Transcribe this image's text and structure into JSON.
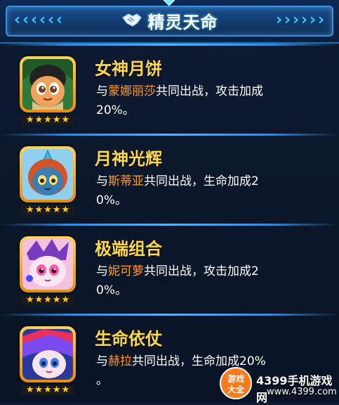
{
  "header": {
    "title": "精灵天命"
  },
  "items": [
    {
      "name": "女神月饼",
      "desc_prefix": "与",
      "partner": "蒙娜丽莎",
      "desc_rest_line1": "共同出战，攻击加成",
      "desc_line2": "20%。",
      "stars": 5
    },
    {
      "name": "月神光辉",
      "desc_prefix": "与",
      "partner": "斯蒂亚",
      "desc_rest_line1": "共同出战，生命加成2",
      "desc_line2": "0%。",
      "stars": 5
    },
    {
      "name": "极端组合",
      "desc_prefix": "与",
      "partner": "妮可萝",
      "desc_rest_line1": "共同出战，攻击加成2",
      "desc_line2": "0%。",
      "stars": 5
    },
    {
      "name": "生命依仗",
      "desc_prefix": "与",
      "partner": "赫拉",
      "desc_rest_line1": "共同出战，生命加成20%",
      "desc_line2": "。",
      "stars": 5
    }
  ],
  "watermark": {
    "badge_line1": "游戏",
    "badge_line2": "大全",
    "site_name": "4399手机游戏网",
    "site_url": "www.4399.com"
  },
  "colors": {
    "name": "#ffd84a",
    "partner": "#ff9a2a",
    "accent": "#39c8ff"
  }
}
